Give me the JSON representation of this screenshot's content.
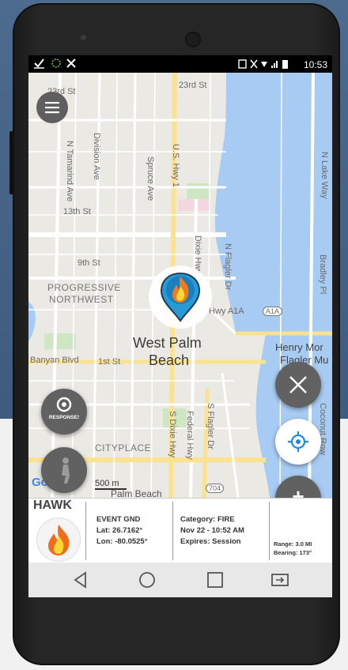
{
  "status_bar": {
    "time": "10:53"
  },
  "map": {
    "streets": [
      "23rd St",
      "13th St",
      "9th St",
      "1st St",
      "N Tamarind Ave",
      "Division Ave",
      "Spruce Ave",
      "U.S. Hwy 1",
      "Dixie Hwy",
      "N Flagler Dr",
      "S Dixie Hwy",
      "Federal Hwy",
      "S Flagler Dr",
      "N Lake Way",
      "Bradley Pl",
      "Coconut Row",
      "Banyan Blvd",
      "A1A",
      "704",
      "Hwy A1A"
    ],
    "neighborhoods": [
      "PROGRESSIVE",
      "NORTHWEST",
      "CITYPLACE",
      "Henry Mor",
      "Flagler Mu"
    ],
    "city": [
      "West Palm",
      "Beach"
    ],
    "partial": [
      "Palm Beach",
      "Tamarind Ave"
    ],
    "scale": "500 m",
    "google": "Goo"
  },
  "buttons": {
    "response_label": "RESPONSE!",
    "add": "+"
  },
  "info": {
    "callsign": "HAWK",
    "event": "EVENT GND",
    "lat": "Lat: 26.7162°",
    "lon": "Lon: -80.0525°",
    "category": "Category: FIRE",
    "datetime": "Nov 22 - 10:52 AM",
    "expires": "Expires: Session",
    "range": "Range: 3.0 MI",
    "bearing": "Bearing: 173°"
  },
  "colors": {
    "water": "#a8cbf3",
    "pin": "#2a9ad6",
    "fab": "#616161"
  }
}
